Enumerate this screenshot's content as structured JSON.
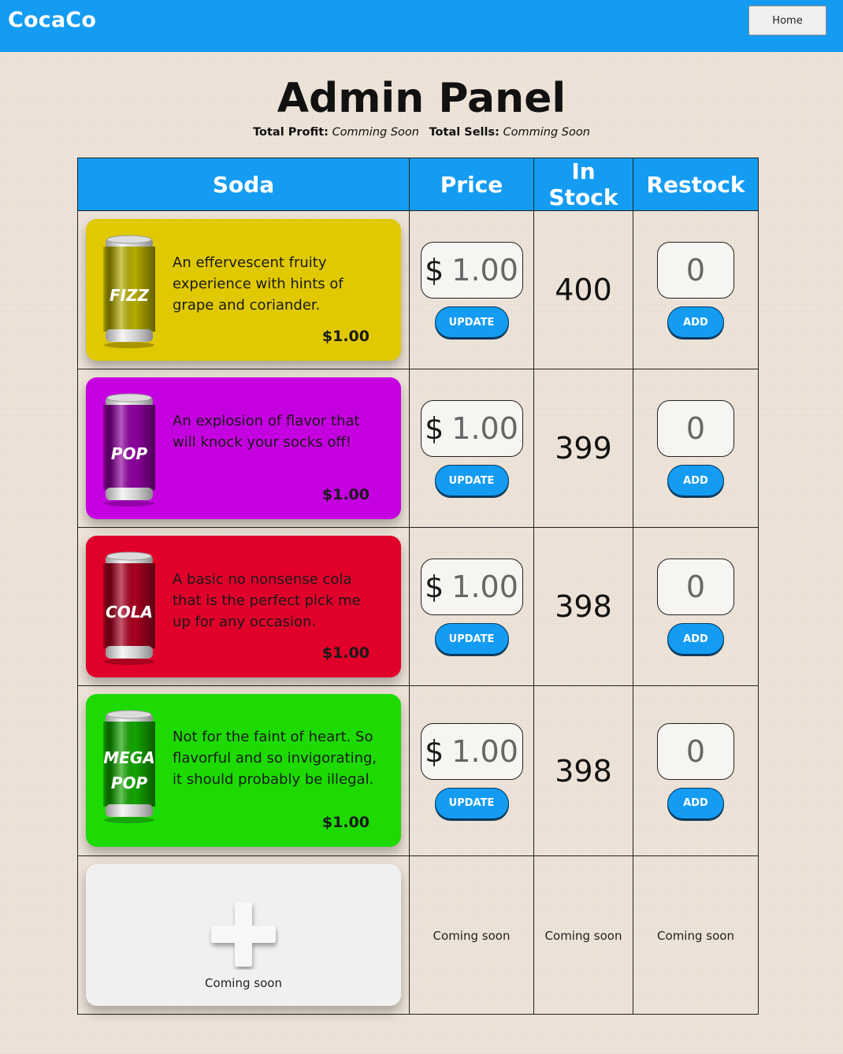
{
  "navbar": {
    "brand": "CocaCo",
    "home_label": "Home"
  },
  "header": {
    "title": "Admin Panel",
    "profit_label": "Total Profit:",
    "profit_value": "Comming Soon",
    "sells_label": "Total Sells:",
    "sells_value": "Comming Soon"
  },
  "table": {
    "columns": [
      "Soda",
      "Price",
      "In Stock",
      "Restock"
    ],
    "update_label": "UPDATE",
    "add_label": "ADD",
    "currency": "$",
    "rows": [
      {
        "can_label": "FIZZ",
        "can_label_2": "",
        "color": "#e0c900",
        "can_color": "#b5ad00",
        "description": "An effervescent fruity experience with hints of grape and coriander.",
        "price_tag": "$1.00",
        "price_value": "1.00",
        "in_stock": "400",
        "restock_value": "0"
      },
      {
        "can_label": "POP",
        "can_label_2": "",
        "color": "#c500e0",
        "can_color": "#8e009e",
        "description": "An explosion of flavor that will knock your socks off!",
        "price_tag": "$1.00",
        "price_value": "1.00",
        "in_stock": "399",
        "restock_value": "0"
      },
      {
        "can_label": "COLA",
        "can_label_2": "",
        "color": "#e0002a",
        "can_color": "#a80020",
        "description": "A basic no nonsense cola that is the perfect pick me up for any occasion.",
        "price_tag": "$1.00",
        "price_value": "1.00",
        "in_stock": "398",
        "restock_value": "0"
      },
      {
        "can_label": "MEGA",
        "can_label_2": "POP",
        "color": "#1ddb00",
        "can_color": "#13a500",
        "description": "Not for the faint of heart. So flavorful and so invigorating, it should probably be illegal.",
        "price_tag": "$1.00",
        "price_value": "1.00",
        "in_stock": "398",
        "restock_value": "0"
      }
    ],
    "new_row": {
      "label": "Coming soon",
      "price": "Coming soon",
      "stock": "Coming soon",
      "restock": "Coming soon"
    }
  },
  "colors": {
    "accent": "#149cf3",
    "background": "#efe5da"
  },
  "icons": {
    "add_soda": "plus-icon",
    "can": "soda-can-icon"
  }
}
